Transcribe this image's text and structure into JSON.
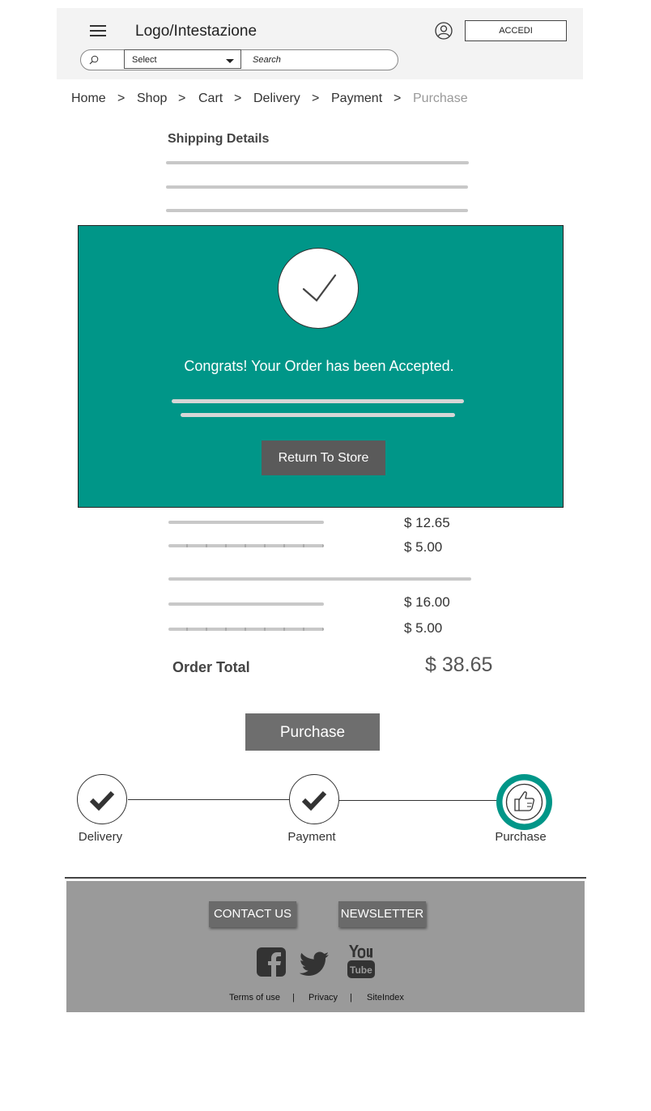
{
  "header": {
    "logo": "Logo/Intestazione",
    "login_label": "ACCEDI",
    "select_label": "Select",
    "search_placeholder": "Search"
  },
  "breadcrumb": {
    "items": [
      "Home",
      "Shop",
      "Cart",
      "Delivery",
      "Payment",
      "Purchase"
    ],
    "separator": ">"
  },
  "shipping": {
    "title": "Shipping Details"
  },
  "modal": {
    "message": "Congrats! Your Order has been Accepted.",
    "return_label": "Return To Store",
    "background": "#009688"
  },
  "summary": {
    "prices": [
      "$ 12.65",
      "$ 5.00",
      "$ 16.00",
      "$ 5.00"
    ],
    "order_total_label": "Order Total",
    "order_total_value": "$ 38.65",
    "purchase_label": "Purchase"
  },
  "steps": {
    "items": [
      "Delivery",
      "Payment",
      "Purchase"
    ],
    "accent": "#009688"
  },
  "footer": {
    "contact_label": "CONTACT US",
    "newsletter_label": "NEWSLETTER",
    "links": [
      "Terms of use",
      "Privacy",
      "SiteIndex"
    ],
    "separator": "|",
    "social_icons": [
      "facebook-icon",
      "twitter-icon",
      "youtube-icon"
    ]
  }
}
